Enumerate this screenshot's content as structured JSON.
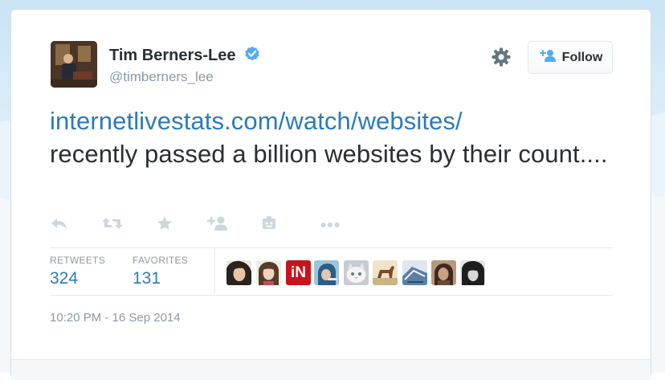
{
  "user": {
    "full_name": "Tim Berners-Lee",
    "screen_name": "@timberners_lee",
    "verified": true
  },
  "follow_button": {
    "label": "Follow"
  },
  "tweet": {
    "link_text": "internetlivestats.com/watch/websites/",
    "body_text": "recently passed a billion websites by their count...."
  },
  "actions": [
    "reply-icon",
    "retweet-icon",
    "favorite-icon",
    "follow-icon",
    "embed-icon",
    "more-icon"
  ],
  "stats": {
    "retweets_label": "RETWEETS",
    "retweets_value": "324",
    "favorites_label": "FAVORITES",
    "favorites_value": "131"
  },
  "favoriters": [
    {
      "name": "favoriter-avatar-1"
    },
    {
      "name": "favoriter-avatar-2"
    },
    {
      "name": "favoriter-avatar-3",
      "text": "iN"
    },
    {
      "name": "favoriter-avatar-4"
    },
    {
      "name": "favoriter-avatar-5"
    },
    {
      "name": "favoriter-avatar-6"
    },
    {
      "name": "favoriter-avatar-7"
    },
    {
      "name": "favoriter-avatar-8"
    },
    {
      "name": "favoriter-avatar-9"
    }
  ],
  "timestamp": "10:20 PM - 16 Sep 2014",
  "colors": {
    "link": "#2b7bb9",
    "text": "#292f33",
    "muted": "#8899a6",
    "verified": "#55acee",
    "icon": "#ccd6dd"
  }
}
